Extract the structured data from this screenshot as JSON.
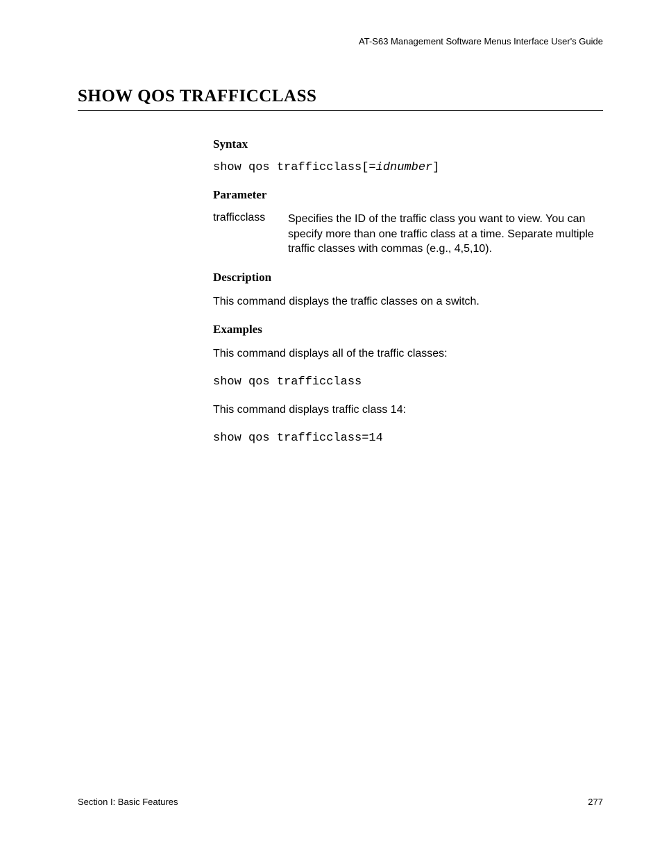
{
  "header": {
    "guide_title": "AT-S63 Management Software Menus Interface User's Guide"
  },
  "title": "SHOW QOS TRAFFICCLASS",
  "sections": {
    "syntax": {
      "heading": "Syntax",
      "command_prefix": "show qos trafficclass[=",
      "command_param": "idnumber",
      "command_suffix": "]"
    },
    "parameter": {
      "heading": "Parameter",
      "name": "trafficclass",
      "description": "Specifies the ID of the traffic class you want to view. You can specify more than one traffic class at a time. Separate multiple traffic classes with commas (e.g., 4,5,10)."
    },
    "description": {
      "heading": "Description",
      "text": "This command displays the traffic classes on a switch."
    },
    "examples": {
      "heading": "Examples",
      "intro1": "This command displays all of the traffic classes:",
      "command1": "show qos trafficclass",
      "intro2": "This command displays traffic class 14:",
      "command2": "show qos trafficclass=14"
    }
  },
  "footer": {
    "section_label": "Section I: Basic Features",
    "page_number": "277"
  }
}
